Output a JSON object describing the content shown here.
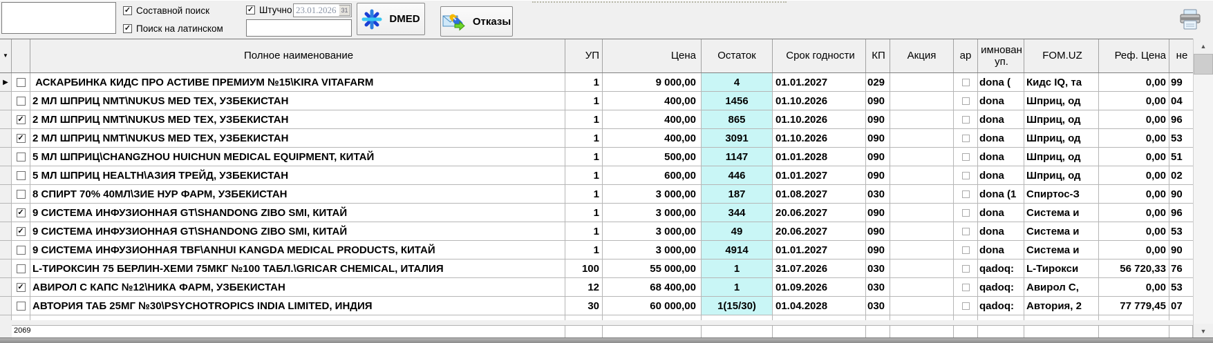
{
  "toolbar": {
    "search_value": "",
    "composite_search_label": "Составной поиск",
    "composite_checked": true,
    "latin_search_label": "Поиск на латинском",
    "latin_checked": true,
    "piece_label": "Штучно",
    "piece_checked": true,
    "date_value": "23.01.2026",
    "calendar_button_label": "31",
    "secondary_search_value": "",
    "dmed_button_label": "DMED",
    "rejects_button_label": "Отказы"
  },
  "grid": {
    "columns": {
      "name": "Полное наименование",
      "up": "УП",
      "price": "Цена",
      "stock": "Остаток",
      "expiry": "Срок годности",
      "kp": "КП",
      "promo": "Акция",
      "nar": "ар",
      "pack": "имнован уп.",
      "fom": "FOM.UZ",
      "ref": "Реф. Цена",
      "ne": "не"
    },
    "rows": [
      {
        "selected": true,
        "checked": false,
        "name": " АСКАРБИНКА КИДС ПРО АСТИВЕ ПРЕМИУМ №15\\KIRA VITAFARM",
        "up": "1",
        "price": "9 000,00",
        "stock": "4",
        "expiry": "01.01.2027",
        "kp": "029",
        "promo": "",
        "pack": "dona (",
        "fom": "Кидс IQ, та",
        "ref_price": "0,00",
        "ne": "99"
      },
      {
        "selected": false,
        "checked": false,
        "name": "2 МЛ ШПРИЦ NMT\\NUKUS MED TEX, УЗБЕКИСТАН",
        "up": "1",
        "price": "400,00",
        "stock": "1456",
        "expiry": "01.10.2026",
        "kp": "090",
        "promo": "",
        "pack": "dona",
        "fom": "Шприц, од",
        "ref_price": "0,00",
        "ne": "04"
      },
      {
        "selected": false,
        "checked": true,
        "name": "2 МЛ ШПРИЦ NMT\\NUKUS MED TEX, УЗБЕКИСТАН",
        "up": "1",
        "price": "400,00",
        "stock": "865",
        "expiry": "01.10.2026",
        "kp": "090",
        "promo": "",
        "pack": "dona",
        "fom": "Шприц, од",
        "ref_price": "0,00",
        "ne": "96"
      },
      {
        "selected": false,
        "checked": true,
        "name": "2 МЛ ШПРИЦ NMT\\NUKUS MED TEX, УЗБЕКИСТАН",
        "up": "1",
        "price": "400,00",
        "stock": "3091",
        "expiry": "01.10.2026",
        "kp": "090",
        "promo": "",
        "pack": "dona",
        "fom": "Шприц, од",
        "ref_price": "0,00",
        "ne": "53"
      },
      {
        "selected": false,
        "checked": false,
        "name": "5 МЛ ШПРИЦ\\CHANGZHOU HUICHUN MEDICAL EQUIPMENT, КИТАЙ",
        "up": "1",
        "price": "500,00",
        "stock": "1147",
        "expiry": "01.01.2028",
        "kp": "090",
        "promo": "",
        "pack": "dona",
        "fom": "Шприц, од",
        "ref_price": "0,00",
        "ne": "51"
      },
      {
        "selected": false,
        "checked": false,
        "name": "5 МЛ ШПРИЦ HEALTH\\АЗИЯ ТРЕЙД, УЗБЕКИСТАН",
        "up": "1",
        "price": "600,00",
        "stock": "446",
        "expiry": "01.01.2027",
        "kp": "090",
        "promo": "",
        "pack": "dona",
        "fom": "Шприц, од",
        "ref_price": "0,00",
        "ne": "02"
      },
      {
        "selected": false,
        "checked": false,
        "name": "8 СПИРТ 70% 40МЛ\\ЗИЕ НУР ФАРМ, УЗБЕКИСТАН",
        "up": "1",
        "price": "3 000,00",
        "stock": "187",
        "expiry": "01.08.2027",
        "kp": "030",
        "promo": "",
        "pack": "dona (1",
        "fom": "Спиртос-З",
        "ref_price": "0,00",
        "ne": "90"
      },
      {
        "selected": false,
        "checked": true,
        "name": "9 СИСТЕМА ИНФУЗИОННАЯ GT\\SHANDONG ZIBO SMI, КИТАЙ",
        "up": "1",
        "price": "3 000,00",
        "stock": "344",
        "expiry": "20.06.2027",
        "kp": "090",
        "promo": "",
        "pack": "dona",
        "fom": "Система и",
        "ref_price": "0,00",
        "ne": "96"
      },
      {
        "selected": false,
        "checked": true,
        "name": "9 СИСТЕМА ИНФУЗИОННАЯ GT\\SHANDONG ZIBO SMI, КИТАЙ",
        "up": "1",
        "price": "3 000,00",
        "stock": "49",
        "expiry": "20.06.2027",
        "kp": "090",
        "promo": "",
        "pack": "dona",
        "fom": "Система и",
        "ref_price": "0,00",
        "ne": "53"
      },
      {
        "selected": false,
        "checked": false,
        "name": "9 СИСТЕМА ИНФУЗИОННАЯ TBF\\ANHUI KANGDA MEDICAL PRODUCTS, КИТАЙ",
        "up": "1",
        "price": "3 000,00",
        "stock": "4914",
        "expiry": "01.01.2027",
        "kp": "090",
        "promo": "",
        "pack": "dona",
        "fom": "Система и",
        "ref_price": "0,00",
        "ne": "90"
      },
      {
        "selected": false,
        "checked": false,
        "name": "L-ТИРОКСИН 75 БЕРЛИН-ХЕМИ 75МКГ №100 ТАБЛ.\\GRICAR CHEMICAL, ИТАЛИЯ",
        "up": "100",
        "price": "55 000,00",
        "stock": "1",
        "expiry": "31.07.2026",
        "kp": "030",
        "promo": "",
        "pack": "qadoq:",
        "fom": "L-Тирокси",
        "ref_price": "56 720,33",
        "ne": "76"
      },
      {
        "selected": false,
        "checked": true,
        "name": "АВИРОЛ С КАПС №12\\НИКА ФАРМ, УЗБЕКИСТАН",
        "up": "12",
        "price": "68 400,00",
        "stock": "1",
        "expiry": "01.09.2026",
        "kp": "030",
        "promo": "",
        "pack": "qadoq:",
        "fom": "Авирол С,",
        "ref_price": "0,00",
        "ne": "53"
      },
      {
        "selected": false,
        "checked": false,
        "name": "АВТОРИЯ ТАБ 25МГ №30\\PSYCHOTROPICS INDIA LIMITED, ИНДИЯ",
        "up": "30",
        "price": "60 000,00",
        "stock": "1(15/30)",
        "expiry": "01.04.2028",
        "kp": "030",
        "promo": "",
        "pack": "qadoq:",
        "fom": "Автория, 2",
        "ref_price": "77 779,45",
        "ne": "07"
      }
    ]
  },
  "footer": {
    "count": "2069"
  },
  "colors": {
    "stock_highlight": "#c9f6f6",
    "grid_line": "#b6b6b6",
    "toolbar_bg": "#f0f0f0"
  }
}
